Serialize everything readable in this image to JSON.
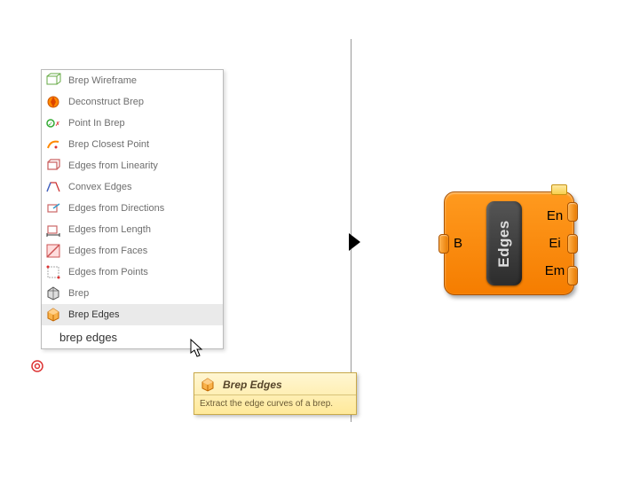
{
  "menu": {
    "items": [
      {
        "label": "Brep Wireframe",
        "icon": "wireframe-icon"
      },
      {
        "label": "Deconstruct Brep",
        "icon": "deconstruct-icon"
      },
      {
        "label": "Point In Brep",
        "icon": "point-in-brep-icon"
      },
      {
        "label": "Brep Closest Point",
        "icon": "closest-point-icon"
      },
      {
        "label": "Edges from Linearity",
        "icon": "edges-linearity-icon"
      },
      {
        "label": "Convex Edges",
        "icon": "convex-edges-icon"
      },
      {
        "label": "Edges from Directions",
        "icon": "edges-directions-icon"
      },
      {
        "label": "Edges from Length",
        "icon": "edges-length-icon"
      },
      {
        "label": "Edges from Faces",
        "icon": "edges-faces-icon"
      },
      {
        "label": "Edges from Points",
        "icon": "edges-points-icon"
      },
      {
        "label": "Brep",
        "icon": "brep-icon"
      },
      {
        "label": "Brep Edges",
        "icon": "brep-edges-icon",
        "selected": true
      }
    ],
    "search_value": "brep edges"
  },
  "tooltip": {
    "title": "Brep Edges",
    "body": "Extract the edge curves of a brep."
  },
  "node": {
    "center_label": "Edges",
    "input_label": "B",
    "outputs": [
      "En",
      "Ei",
      "Em"
    ]
  },
  "colors": {
    "node_fill": "#f57d00",
    "tooltip_fill": "#ffe99a"
  }
}
